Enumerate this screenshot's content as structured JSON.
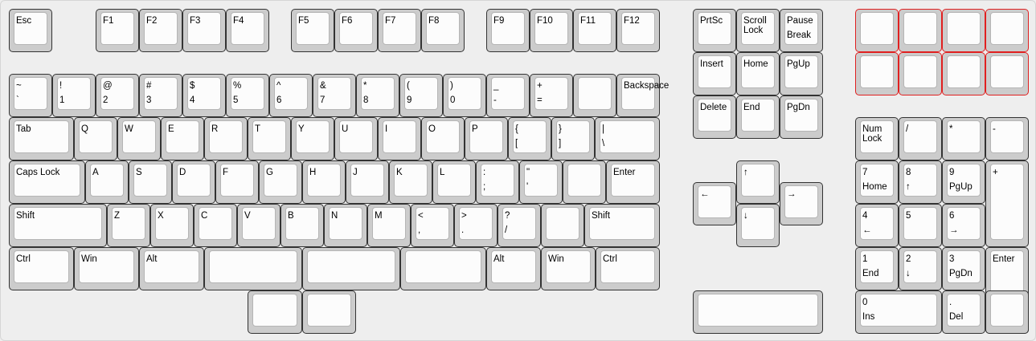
{
  "accent_red": "#e02020",
  "keys": [
    {
      "id": "esc",
      "t": "Esc"
    },
    {
      "id": "f1",
      "t": "F1"
    },
    {
      "id": "f2",
      "t": "F2"
    },
    {
      "id": "f3",
      "t": "F3"
    },
    {
      "id": "f4",
      "t": "F4"
    },
    {
      "id": "f5",
      "t": "F5"
    },
    {
      "id": "f6",
      "t": "F6"
    },
    {
      "id": "f7",
      "t": "F7"
    },
    {
      "id": "f8",
      "t": "F8"
    },
    {
      "id": "f9",
      "t": "F9"
    },
    {
      "id": "f10",
      "t": "F10"
    },
    {
      "id": "f11",
      "t": "F11"
    },
    {
      "id": "f12",
      "t": "F12"
    },
    {
      "id": "prtsc",
      "t": "PrtSc"
    },
    {
      "id": "scroll-lock",
      "t": "Scroll\nLock"
    },
    {
      "id": "pause-break",
      "t": "Pause",
      "b": "Break"
    },
    {
      "id": "red-1",
      "t": ""
    },
    {
      "id": "red-2",
      "t": ""
    },
    {
      "id": "red-3",
      "t": ""
    },
    {
      "id": "red-4",
      "t": ""
    },
    {
      "id": "red-5",
      "t": ""
    },
    {
      "id": "red-6",
      "t": ""
    },
    {
      "id": "red-7",
      "t": ""
    },
    {
      "id": "red-8",
      "t": ""
    },
    {
      "id": "grave",
      "t": "~",
      "b": "`"
    },
    {
      "id": "1",
      "t": "!",
      "b": "1"
    },
    {
      "id": "2",
      "t": "@",
      "b": "2"
    },
    {
      "id": "3",
      "t": "#",
      "b": "3"
    },
    {
      "id": "4",
      "t": "$",
      "b": "4"
    },
    {
      "id": "5",
      "t": "%",
      "b": "5"
    },
    {
      "id": "6",
      "t": "^",
      "b": "6"
    },
    {
      "id": "7",
      "t": "&",
      "b": "7"
    },
    {
      "id": "8",
      "t": "*",
      "b": "8"
    },
    {
      "id": "9",
      "t": "(",
      "b": "9"
    },
    {
      "id": "0",
      "t": ")",
      "b": "0"
    },
    {
      "id": "minus",
      "t": "_",
      "b": "-"
    },
    {
      "id": "equals",
      "t": "+",
      "b": "="
    },
    {
      "id": "blank-num-row",
      "t": ""
    },
    {
      "id": "backspace",
      "t": "Backspace"
    },
    {
      "id": "insert",
      "t": "Insert"
    },
    {
      "id": "home",
      "t": "Home"
    },
    {
      "id": "pgup",
      "t": "PgUp"
    },
    {
      "id": "tab",
      "t": "Tab"
    },
    {
      "id": "q",
      "t": "Q"
    },
    {
      "id": "w",
      "t": "W"
    },
    {
      "id": "e",
      "t": "E"
    },
    {
      "id": "r",
      "t": "R"
    },
    {
      "id": "t",
      "t": "T"
    },
    {
      "id": "y",
      "t": "Y"
    },
    {
      "id": "u",
      "t": "U"
    },
    {
      "id": "i",
      "t": "I"
    },
    {
      "id": "o",
      "t": "O"
    },
    {
      "id": "p",
      "t": "P"
    },
    {
      "id": "lbracket",
      "t": "{",
      "b": "["
    },
    {
      "id": "rbracket",
      "t": "}",
      "b": "]"
    },
    {
      "id": "backslash",
      "t": "|",
      "b": "\\"
    },
    {
      "id": "delete",
      "t": "Delete"
    },
    {
      "id": "end",
      "t": "End"
    },
    {
      "id": "pgdn",
      "t": "PgDn"
    },
    {
      "id": "numlock",
      "t": "Num\nLock"
    },
    {
      "id": "np-slash",
      "t": "/"
    },
    {
      "id": "np-star",
      "t": "*"
    },
    {
      "id": "np-minus",
      "t": "-"
    },
    {
      "id": "capslock",
      "t": "Caps Lock"
    },
    {
      "id": "a",
      "t": "A"
    },
    {
      "id": "s",
      "t": "S"
    },
    {
      "id": "d",
      "t": "D"
    },
    {
      "id": "f",
      "t": "F"
    },
    {
      "id": "g",
      "t": "G"
    },
    {
      "id": "h",
      "t": "H"
    },
    {
      "id": "j",
      "t": "J"
    },
    {
      "id": "k",
      "t": "K"
    },
    {
      "id": "l",
      "t": "L"
    },
    {
      "id": "semicolon",
      "t": ":",
      "b": ";"
    },
    {
      "id": "quote",
      "t": "\"",
      "b": "'"
    },
    {
      "id": "blank-home-row",
      "t": ""
    },
    {
      "id": "enter",
      "t": "Enter"
    },
    {
      "id": "np-7",
      "t": "7",
      "b": "Home"
    },
    {
      "id": "np-8",
      "t": "8",
      "b": "↑"
    },
    {
      "id": "np-9",
      "t": "9",
      "b": "PgUp"
    },
    {
      "id": "np-plus",
      "t": "+"
    },
    {
      "id": "arrow-up",
      "t": "↑"
    },
    {
      "id": "arrow-left",
      "t": "←"
    },
    {
      "id": "arrow-right",
      "t": "→"
    },
    {
      "id": "lshift",
      "t": "Shift"
    },
    {
      "id": "z",
      "t": "Z"
    },
    {
      "id": "x",
      "t": "X"
    },
    {
      "id": "c",
      "t": "C"
    },
    {
      "id": "v",
      "t": "V"
    },
    {
      "id": "b",
      "t": "B"
    },
    {
      "id": "n",
      "t": "N"
    },
    {
      "id": "m",
      "t": "M"
    },
    {
      "id": "comma",
      "t": "<",
      "b": ","
    },
    {
      "id": "period",
      "t": ">",
      "b": "."
    },
    {
      "id": "slash",
      "t": "?",
      "b": "/"
    },
    {
      "id": "blank-shift-row",
      "t": ""
    },
    {
      "id": "rshift",
      "t": "Shift"
    },
    {
      "id": "arrow-down",
      "t": "↓"
    },
    {
      "id": "np-4",
      "t": "4",
      "b": "←"
    },
    {
      "id": "np-5",
      "t": "5"
    },
    {
      "id": "np-6",
      "t": "6",
      "b": "→"
    },
    {
      "id": "lctrl",
      "t": "Ctrl"
    },
    {
      "id": "lwin",
      "t": "Win"
    },
    {
      "id": "lalt",
      "t": "Alt"
    },
    {
      "id": "space-1",
      "t": ""
    },
    {
      "id": "space-2",
      "t": ""
    },
    {
      "id": "space-3",
      "t": ""
    },
    {
      "id": "ralt",
      "t": "Alt"
    },
    {
      "id": "rwin",
      "t": "Win"
    },
    {
      "id": "rctrl",
      "t": "Ctrl"
    },
    {
      "id": "np-1",
      "t": "1",
      "b": "End"
    },
    {
      "id": "np-2",
      "t": "2",
      "b": "↓"
    },
    {
      "id": "np-3",
      "t": "3",
      "b": "PgDn"
    },
    {
      "id": "np-enter",
      "t": "Enter"
    },
    {
      "id": "thumb-1",
      "t": ""
    },
    {
      "id": "thumb-2",
      "t": ""
    },
    {
      "id": "bottom-wide",
      "t": ""
    },
    {
      "id": "np-0",
      "t": "0",
      "b": "Ins"
    },
    {
      "id": "np-dot",
      "t": ".",
      "b": "Del"
    },
    {
      "id": "np-blank",
      "t": ""
    }
  ]
}
